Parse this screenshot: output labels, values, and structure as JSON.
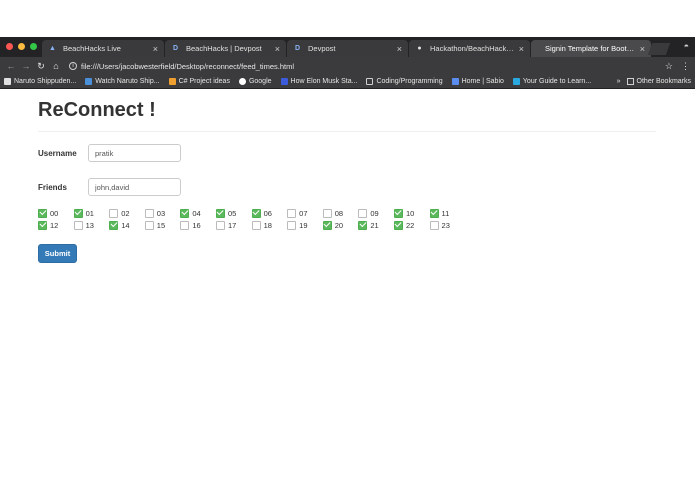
{
  "browser": {
    "tabs": [
      {
        "title": "BeachHacks Live",
        "icon": "beachhacks-icon",
        "active": false
      },
      {
        "title": "BeachHacks | Devpost",
        "icon": "devpost-icon",
        "active": false
      },
      {
        "title": "Devpost",
        "icon": "devpost-icon",
        "active": false
      },
      {
        "title": "Hackathon/BeachHacks at ma",
        "icon": "github-icon",
        "active": false
      },
      {
        "title": "Signin Template for Bootstrap",
        "icon": "",
        "active": true
      }
    ],
    "url": "file:///Users/jacobwesterfield/Desktop/reconnect/feed_times.html",
    "bookmarks": [
      {
        "label": "Naruto Shippuden..."
      },
      {
        "label": "Watch Naruto Ship..."
      },
      {
        "label": "C# Project ideas"
      },
      {
        "label": "Google"
      },
      {
        "label": "How Elon Musk Sta..."
      },
      {
        "label": "Coding/Programming"
      },
      {
        "label": "Home | Sabio"
      },
      {
        "label": "Your Guide to Learn..."
      }
    ],
    "other_bookmarks": "Other Bookmarks",
    "bookmarks_overflow": "»"
  },
  "page": {
    "title": "ReConnect !",
    "username_label": "Username",
    "username_value": "pratik",
    "friends_label": "Friends",
    "friends_value": "john,david",
    "hours": [
      {
        "label": "00",
        "checked": true
      },
      {
        "label": "01",
        "checked": true
      },
      {
        "label": "02",
        "checked": false
      },
      {
        "label": "03",
        "checked": false
      },
      {
        "label": "04",
        "checked": true
      },
      {
        "label": "05",
        "checked": true
      },
      {
        "label": "06",
        "checked": true
      },
      {
        "label": "07",
        "checked": false
      },
      {
        "label": "08",
        "checked": false
      },
      {
        "label": "09",
        "checked": false
      },
      {
        "label": "10",
        "checked": true
      },
      {
        "label": "11",
        "checked": true
      },
      {
        "label": "12",
        "checked": true
      },
      {
        "label": "13",
        "checked": false
      },
      {
        "label": "14",
        "checked": true
      },
      {
        "label": "15",
        "checked": false
      },
      {
        "label": "16",
        "checked": false
      },
      {
        "label": "17",
        "checked": false
      },
      {
        "label": "18",
        "checked": false
      },
      {
        "label": "19",
        "checked": false
      },
      {
        "label": "20",
        "checked": true
      },
      {
        "label": "21",
        "checked": true
      },
      {
        "label": "22",
        "checked": true
      },
      {
        "label": "23",
        "checked": false
      }
    ],
    "submit_label": "Submit"
  },
  "colors": {
    "checkbox_checked": "#5cb85c",
    "submit_button": "#337ab7",
    "browser_chrome": "#2b2b2d"
  }
}
